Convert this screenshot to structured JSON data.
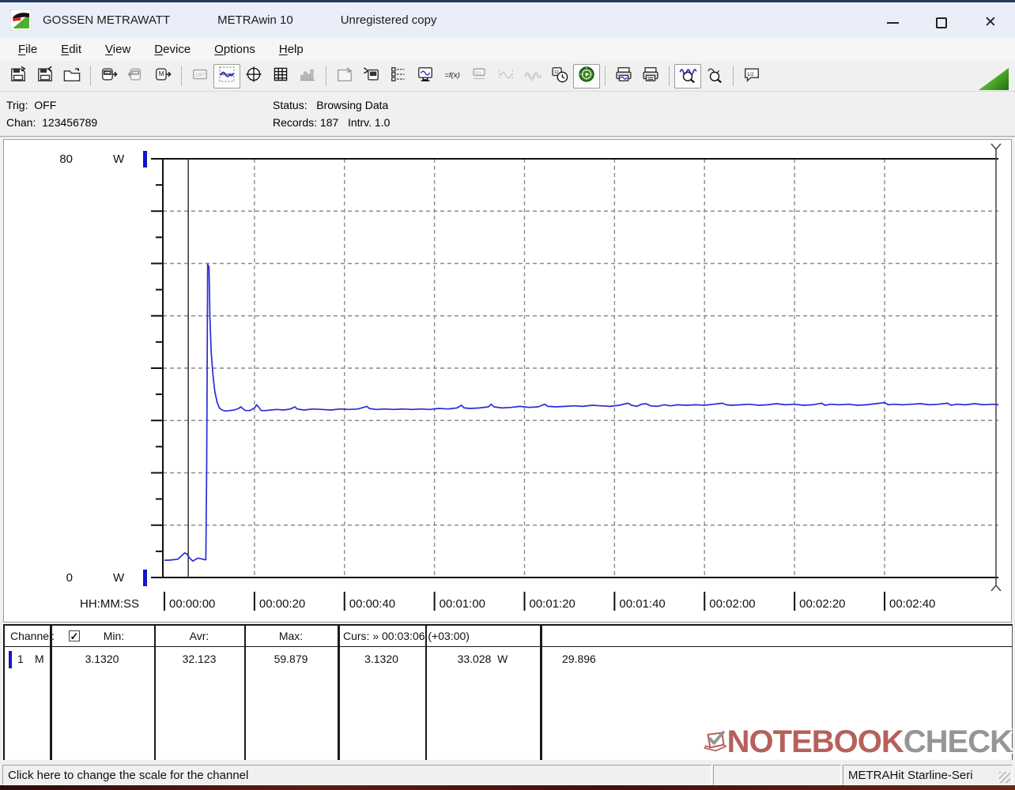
{
  "window": {
    "brand": "GOSSEN METRAWATT",
    "app": "METRAwin 10",
    "license": "Unregistered copy"
  },
  "menu": {
    "items": [
      {
        "label": "File"
      },
      {
        "label": "Edit"
      },
      {
        "label": "View"
      },
      {
        "label": "Device"
      },
      {
        "label": "Options"
      },
      {
        "label": "Help"
      }
    ]
  },
  "toolbar": {
    "buttons": [
      {
        "name": "load-file",
        "icon": "floppy-out",
        "state": "normal",
        "group_end": false
      },
      {
        "name": "save-file",
        "icon": "floppy-in",
        "state": "normal",
        "group_end": false
      },
      {
        "name": "open-folder",
        "icon": "folder",
        "state": "normal",
        "group_end": true
      },
      {
        "name": "read-device",
        "icon": "meter-out",
        "state": "normal",
        "group_end": false
      },
      {
        "name": "write-device",
        "icon": "meter-in",
        "state": "disabled",
        "group_end": false
      },
      {
        "name": "device-memory",
        "icon": "meter-m",
        "state": "normal",
        "group_end": true
      },
      {
        "name": "numeric-display-view",
        "icon": "digits",
        "state": "disabled",
        "group_end": false
      },
      {
        "name": "trend-chart-view",
        "icon": "trend",
        "state": "active",
        "group_end": false
      },
      {
        "name": "xy-scope-view",
        "icon": "scope",
        "state": "normal",
        "group_end": false
      },
      {
        "name": "table-view",
        "icon": "table",
        "state": "normal",
        "group_end": false
      },
      {
        "name": "histogram-view",
        "icon": "histogram",
        "state": "disabled",
        "group_end": true
      },
      {
        "name": "export-data",
        "icon": "disk-export",
        "state": "disabled",
        "group_end": false
      },
      {
        "name": "store-to-device",
        "icon": "device-disk",
        "state": "normal",
        "group_end": false
      },
      {
        "name": "device-settings",
        "icon": "config-list",
        "state": "normal",
        "group_end": false
      },
      {
        "name": "pc-monitor",
        "icon": "monitor-wave",
        "state": "normal",
        "group_end": false
      },
      {
        "name": "formula-function",
        "icon": "fx",
        "state": "normal",
        "group_end": false
      },
      {
        "name": "small-display",
        "icon": "digits-small",
        "state": "disabled",
        "group_end": false
      },
      {
        "name": "wave-segment",
        "icon": "wave-seg",
        "state": "disabled",
        "group_end": false
      },
      {
        "name": "wave-multi",
        "icon": "wave-multi",
        "state": "disabled",
        "group_end": false
      },
      {
        "name": "time-settings",
        "icon": "clock",
        "state": "normal",
        "group_end": false
      },
      {
        "name": "live-record-target",
        "icon": "target",
        "state": "active",
        "group_end": true
      },
      {
        "name": "print-preview",
        "icon": "printer-wave",
        "state": "normal",
        "group_end": false
      },
      {
        "name": "print",
        "icon": "printer",
        "state": "normal",
        "group_end": true
      },
      {
        "name": "zoom-curve-in",
        "icon": "zoom-wave",
        "state": "active",
        "group_end": false
      },
      {
        "name": "zoom-curve-out",
        "icon": "zoom-out",
        "state": "normal",
        "group_end": true
      },
      {
        "name": "annotations",
        "icon": "bubble",
        "state": "normal",
        "group_end": false
      }
    ]
  },
  "info": {
    "trig_label": "Trig:",
    "trig_value": "OFF",
    "chan_label": "Chan:",
    "chan_value": "123456789",
    "status_label": "Status:",
    "status_value": "Browsing Data",
    "records_label": "Records:",
    "records_value": "187",
    "intrv_label": "Intrv.",
    "intrv_value": "1.0"
  },
  "chart_data": {
    "type": "line",
    "title": "",
    "ylabel": "W",
    "unit": "W",
    "ylim": [
      0,
      80
    ],
    "y_top_label": "80",
    "y_bottom_label": "0",
    "y_gridline_step": 10,
    "y_tick_step": 5,
    "x_axis_label": "HH:MM:SS",
    "x_tick_labels": [
      "00:00:00",
      "00:00:20",
      "00:00:40",
      "00:01:00",
      "00:01:20",
      "00:01:40",
      "00:02:00",
      "00:02:20",
      "00:02:40"
    ],
    "x_tick_seconds": [
      0,
      20,
      40,
      60,
      80,
      100,
      120,
      140,
      160
    ],
    "x_range_seconds": [
      0,
      185
    ],
    "grid": true,
    "legend": "none",
    "cursor1_seconds": 5.3,
    "cursor2_seconds": 185,
    "line_color": "#2b2bd6",
    "series": [
      {
        "name": "Channel 1",
        "unit": "W",
        "points": [
          [
            0,
            3.3
          ],
          [
            1,
            3.3
          ],
          [
            2,
            3.4
          ],
          [
            3,
            3.5
          ],
          [
            3.5,
            3.9
          ],
          [
            4,
            4.3
          ],
          [
            4.5,
            4.7
          ],
          [
            5,
            4.5
          ],
          [
            5.5,
            3.8
          ],
          [
            6,
            3.4
          ],
          [
            6.3,
            3.13
          ],
          [
            7,
            3.5
          ],
          [
            7.5,
            3.7
          ],
          [
            8,
            3.6
          ],
          [
            8.5,
            3.5
          ],
          [
            9,
            3.4
          ],
          [
            9.2,
            3.4
          ],
          [
            9.4,
            22
          ],
          [
            9.6,
            59.88
          ],
          [
            9.9,
            59.3
          ],
          [
            10.1,
            50
          ],
          [
            10.4,
            43
          ],
          [
            10.8,
            38.5
          ],
          [
            11.2,
            35.5
          ],
          [
            11.7,
            33.5
          ],
          [
            12.2,
            32.4
          ],
          [
            12.8,
            32.0
          ],
          [
            13.5,
            31.8
          ],
          [
            14.5,
            31.9
          ],
          [
            15.5,
            32.0
          ],
          [
            16.5,
            32.3
          ],
          [
            17,
            32.6
          ],
          [
            17.5,
            32.2
          ],
          [
            18,
            31.9
          ],
          [
            19,
            31.9
          ],
          [
            20,
            32.4
          ],
          [
            20.5,
            33.0
          ],
          [
            21,
            32.5
          ],
          [
            21.5,
            31.9
          ],
          [
            22.5,
            31.9
          ],
          [
            23.5,
            32.0
          ],
          [
            25,
            32.1
          ],
          [
            26.5,
            32.0
          ],
          [
            28,
            32.2
          ],
          [
            29,
            32.6
          ],
          [
            29.5,
            32.2
          ],
          [
            31,
            32.0
          ],
          [
            33,
            32.2
          ],
          [
            35,
            32.1
          ],
          [
            37,
            32.0
          ],
          [
            39,
            32.2
          ],
          [
            41,
            32.1
          ],
          [
            43,
            32.2
          ],
          [
            45,
            32.7
          ],
          [
            45.5,
            32.3
          ],
          [
            47,
            32.1
          ],
          [
            49,
            32.2
          ],
          [
            51,
            32.1
          ],
          [
            53,
            32.2
          ],
          [
            55,
            32.1
          ],
          [
            57,
            32.2
          ],
          [
            59,
            32.1
          ],
          [
            61,
            32.3
          ],
          [
            63,
            32.2
          ],
          [
            65,
            32.4
          ],
          [
            66,
            32.9
          ],
          [
            66.6,
            32.4
          ],
          [
            68,
            32.3
          ],
          [
            70,
            32.4
          ],
          [
            72,
            32.6
          ],
          [
            72.6,
            33.1
          ],
          [
            73.2,
            32.6
          ],
          [
            75,
            32.4
          ],
          [
            77,
            32.5
          ],
          [
            79,
            32.7
          ],
          [
            81,
            32.5
          ],
          [
            83,
            32.6
          ],
          [
            84.5,
            33.1
          ],
          [
            85.2,
            32.7
          ],
          [
            87,
            32.6
          ],
          [
            89,
            32.7
          ],
          [
            91,
            32.8
          ],
          [
            93,
            32.7
          ],
          [
            95,
            32.9
          ],
          [
            97,
            32.8
          ],
          [
            99,
            32.7
          ],
          [
            101,
            32.9
          ],
          [
            103,
            33.3
          ],
          [
            103.8,
            32.9
          ],
          [
            105,
            32.7
          ],
          [
            106,
            33.1
          ],
          [
            107,
            33.2
          ],
          [
            108,
            32.8
          ],
          [
            109.5,
            32.7
          ],
          [
            111,
            33.0
          ],
          [
            112.5,
            32.8
          ],
          [
            114,
            33.0
          ],
          [
            116,
            32.9
          ],
          [
            118,
            33.0
          ],
          [
            120,
            32.9
          ],
          [
            122,
            33.1
          ],
          [
            124,
            33.3
          ],
          [
            124.8,
            33.0
          ],
          [
            126,
            32.9
          ],
          [
            128,
            33.0
          ],
          [
            130,
            33.1
          ],
          [
            132,
            32.9
          ],
          [
            134,
            33.0
          ],
          [
            136,
            33.2
          ],
          [
            138,
            33.0
          ],
          [
            140,
            33.1
          ],
          [
            142,
            32.9
          ],
          [
            144,
            33.0
          ],
          [
            146,
            33.3
          ],
          [
            146.8,
            32.9
          ],
          [
            148,
            33.1
          ],
          [
            150,
            33.0
          ],
          [
            152,
            33.1
          ],
          [
            154,
            32.9
          ],
          [
            156,
            33.0
          ],
          [
            158,
            33.2
          ],
          [
            160,
            33.4
          ],
          [
            160.8,
            33.0
          ],
          [
            162,
            33.1
          ],
          [
            164,
            33.0
          ],
          [
            166,
            33.1
          ],
          [
            168,
            33.2
          ],
          [
            170,
            33.0
          ],
          [
            172,
            33.1
          ],
          [
            174,
            33.3
          ],
          [
            174.8,
            32.9
          ],
          [
            176,
            33.1
          ],
          [
            178,
            33.0
          ],
          [
            180,
            33.2
          ],
          [
            182,
            33.0
          ],
          [
            184,
            33.1
          ],
          [
            185.3,
            33.0
          ]
        ]
      }
    ]
  },
  "table": {
    "header": {
      "channel": "Channel:",
      "min": "Min:",
      "avr": "Avr:",
      "max": "Max:",
      "curs": "Curs: » 00:03:06 (+03:00)"
    },
    "row": {
      "channel": "1",
      "mode": "M",
      "min": "3.1320",
      "avr": "32.123",
      "max": "59.879",
      "curs1": "3.1320",
      "curs2": "33.028",
      "curs2_unit": "W",
      "delta": "29.896"
    }
  },
  "statusbar": {
    "message": "Click here to change the scale for the channel",
    "device": "METRAHit Starline-Seri"
  },
  "watermark": {
    "part1": "NOTEBOOK",
    "part2": "CHECK"
  },
  "colors": {
    "accent_line": "#2b2bd6",
    "title_border": "#24395c",
    "bottom_strip": "#5c1c12",
    "watermark_red": "#b2544e",
    "watermark_gray": "#8d8d8d"
  }
}
